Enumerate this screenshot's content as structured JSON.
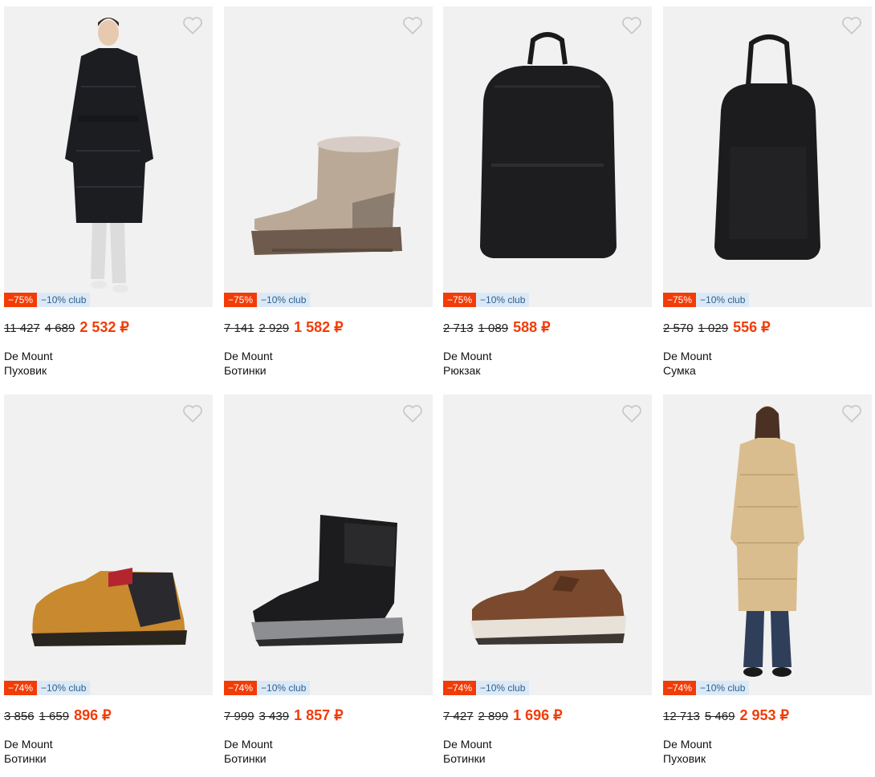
{
  "products": [
    {
      "id": "p1",
      "old1": "11 427",
      "old2": "4 689",
      "price": "2 532 ₽",
      "discount": "−75%",
      "club": "−10% club",
      "brand": "De Mount",
      "type": "Пуховик"
    },
    {
      "id": "p2",
      "old1": "7 141",
      "old2": "2 929",
      "price": "1 582 ₽",
      "discount": "−75%",
      "club": "−10% club",
      "brand": "De Mount",
      "type": "Ботинки"
    },
    {
      "id": "p3",
      "old1": "2 713",
      "old2": "1 089",
      "price": "588 ₽",
      "discount": "−75%",
      "club": "−10% club",
      "brand": "De Mount",
      "type": "Рюкзак"
    },
    {
      "id": "p4",
      "old1": "2 570",
      "old2": "1 029",
      "price": "556 ₽",
      "discount": "−75%",
      "club": "−10% club",
      "brand": "De Mount",
      "type": "Сумка"
    },
    {
      "id": "p5",
      "old1": "3 856",
      "old2": "1 659",
      "price": "896 ₽",
      "discount": "−74%",
      "club": "−10% club",
      "brand": "De Mount",
      "type": "Ботинки"
    },
    {
      "id": "p6",
      "old1": "7 999",
      "old2": "3 439",
      "price": "1 857 ₽",
      "discount": "−74%",
      "club": "−10% club",
      "brand": "De Mount",
      "type": "Ботинки"
    },
    {
      "id": "p7",
      "old1": "7 427",
      "old2": "2 899",
      "price": "1 696 ₽",
      "discount": "−74%",
      "club": "−10% club",
      "brand": "De Mount",
      "type": "Ботинки"
    },
    {
      "id": "p8",
      "old1": "12 713",
      "old2": "5 469",
      "price": "2 953 ₽",
      "discount": "−74%",
      "club": "−10% club",
      "brand": "De Mount",
      "type": "Пуховик"
    }
  ],
  "colors": {
    "accent": "#f23c07",
    "club_bg": "#dbe9f7",
    "club_text": "#2f5f8a",
    "card_bg": "#f1f1f1"
  },
  "icons": {
    "favorite": "heart-outline-icon"
  }
}
